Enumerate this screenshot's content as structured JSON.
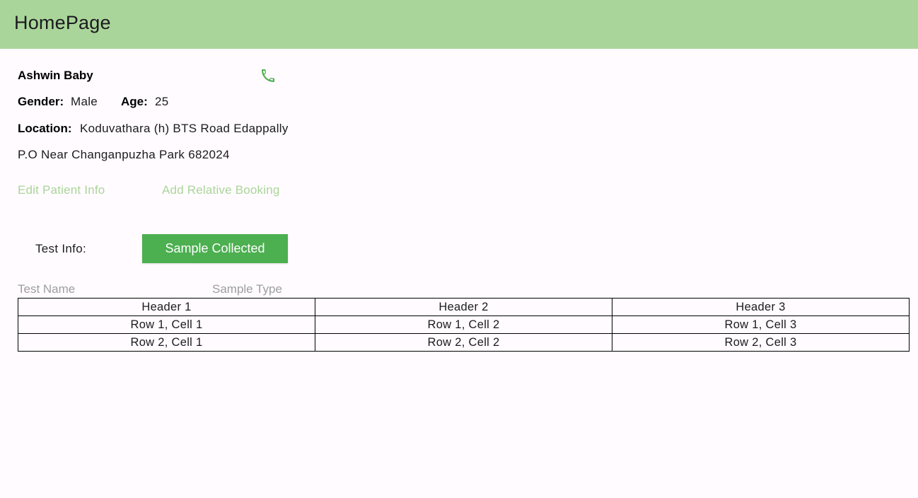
{
  "appbar": {
    "title": "HomePage"
  },
  "patient": {
    "name": "Ashwin Baby",
    "gender_label": "Gender:",
    "gender_value": "Male",
    "age_label": "Age:",
    "age_value": "25",
    "location_label": "Location:",
    "location_line1": "Koduvathara (h) BTS Road Edappally",
    "location_line2": "P.O Near Changanpuzha Park 682024",
    "call_icon": "phone-icon"
  },
  "actions": {
    "edit_label": "Edit Patient Info",
    "relative_label": "Add Relative Booking"
  },
  "test": {
    "label": "Test Info:",
    "button_label": "Sample Collected",
    "col_name": "Test Name",
    "col_type": "Sample Type"
  },
  "table": {
    "headers": [
      "Header 1",
      "Header 2",
      "Header 3"
    ],
    "rows": [
      [
        "Row 1, Cell 1",
        "Row 1, Cell 2",
        "Row 1, Cell 3"
      ],
      [
        "Row 2, Cell 1",
        "Row 2, Cell 2",
        "Row 2, Cell 3"
      ]
    ]
  },
  "colors": {
    "appbar": "#aad59a",
    "accent": "#4caf50",
    "link": "#aad59a"
  }
}
